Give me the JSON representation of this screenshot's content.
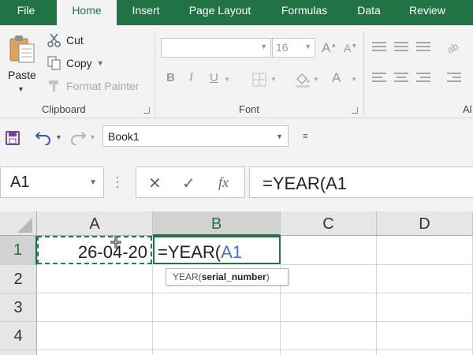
{
  "ribbon_tabs": [
    "File",
    "Home",
    "Insert",
    "Page Layout",
    "Formulas",
    "Data",
    "Review"
  ],
  "clipboard": {
    "paste_label": "Paste",
    "cut_label": "Cut",
    "copy_label": "Copy",
    "format_painter_label": "Format Painter",
    "group_label": "Clipboard"
  },
  "font": {
    "size_value": "16",
    "group_label": "Font",
    "bold": "B",
    "italic": "I",
    "underline": "U",
    "grow_font": "A",
    "shrink_font": "A",
    "font_color": "A"
  },
  "alignment": {
    "group_label_partial": "Al"
  },
  "quick_access": {
    "book_name": "Book1"
  },
  "formula_bar": {
    "name_box": "A1",
    "cancel_symbol": "✕",
    "enter_symbol": "✓",
    "fx_symbol": "fx",
    "formula": "=YEAR(A1"
  },
  "sheet": {
    "columns": [
      "A",
      "B",
      "C",
      "D"
    ],
    "rows": [
      "1",
      "2",
      "3",
      "4"
    ],
    "cell_a1": "26-04-20",
    "cell_b1_prefix": "=YEAR(",
    "cell_b1_ref": "A1"
  },
  "tooltip": {
    "func": "YEAR(",
    "arg": "serial_number",
    "close": ")"
  },
  "colors": {
    "accent": "#217346",
    "ref_blue": "#4472c4",
    "ribbon_bg": "#f3f3f3"
  }
}
